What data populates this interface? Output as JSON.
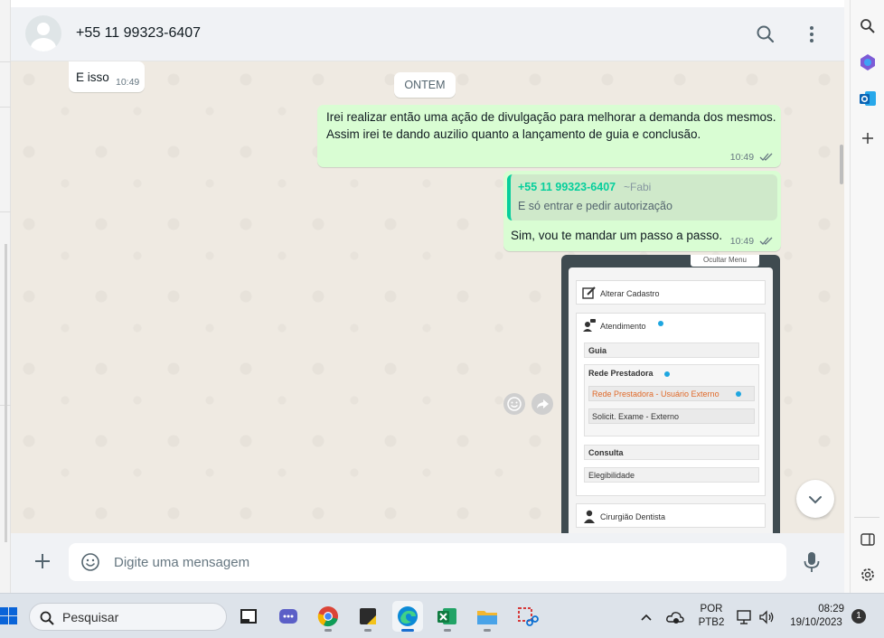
{
  "chat": {
    "contact_name": "+55 11 99323-6407",
    "date_divider": "ONTEM",
    "messages": [
      {
        "direction": "in",
        "text": "E isso",
        "time": "10:49"
      },
      {
        "direction": "out",
        "text": "Irei realizar então uma ação de divulgação para melhorar a demanda dos mesmos. Assim irei te dando auzilio quanto a lançamento de guia e conclusão.",
        "time": "10:49",
        "status": "read"
      },
      {
        "direction": "out",
        "quoted": {
          "author": "+55 11 99323-6407",
          "alias": "~Fabi",
          "text": "E só entrar e pedir autorização"
        },
        "text": "Sim, vou te mandar um passo a passo.",
        "time": "10:49",
        "status": "read"
      }
    ],
    "image_message": {
      "hide_menu_label": "Ocultar Menu",
      "menu": {
        "alterar_cadastro": "Alterar Cadastro",
        "atendimento": "Atendimento",
        "guia": "Guia",
        "rede_prestadora": "Rede Prestadora",
        "rede_externo": "Rede Prestadora - Usuário Externo",
        "solicit_exame": "Solicit. Exame - Externo",
        "consulta": "Consulta",
        "elegibilidade": "Elegibilidade",
        "cirurgiao": "Cirurgião Dentista"
      }
    }
  },
  "composer": {
    "placeholder": "Digite uma mensagem",
    "value": ""
  },
  "taskbar": {
    "search_label": "Pesquisar",
    "language_top": "POR",
    "language_bottom": "PTB2",
    "time": "08:29",
    "date": "19/10/2023",
    "notification_count": "1",
    "apps": [
      "file-explorer-icon",
      "teams-icon",
      "chrome-icon",
      "sticky-icon",
      "edge-icon",
      "excel-icon",
      "folder-icon",
      "snipping-tool-icon"
    ]
  },
  "colors": {
    "chat_background": "#efeae2",
    "outgoing_bubble": "#d9fdd3",
    "incoming_bubble": "#ffffff",
    "accent_green": "#06cf9c",
    "read_ticks": "#53bdeb"
  }
}
